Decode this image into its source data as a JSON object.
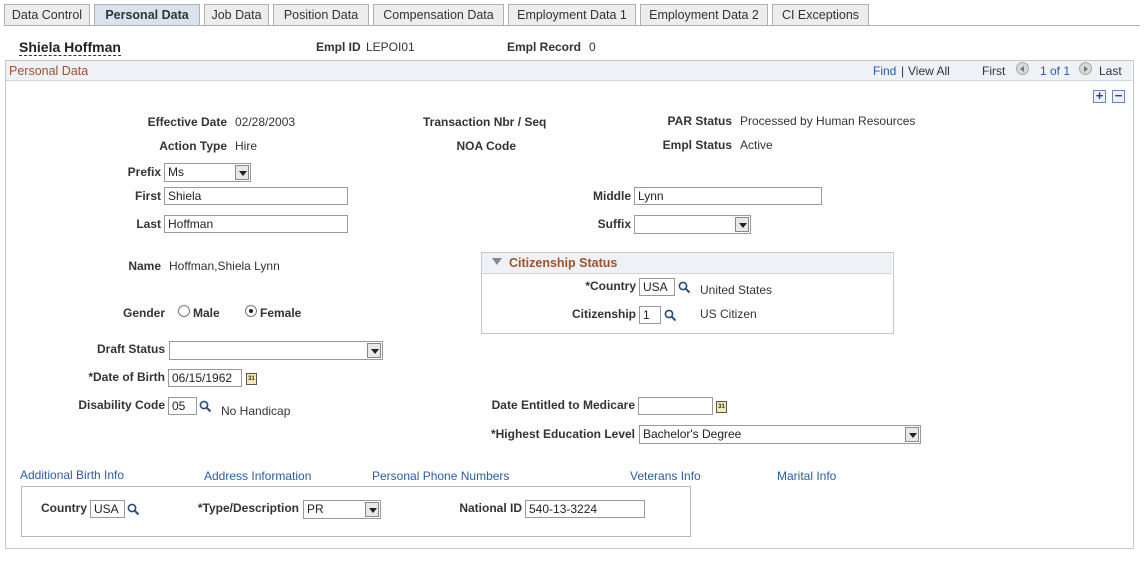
{
  "tabs": [
    {
      "label": "Data Control",
      "active": false
    },
    {
      "label": "Personal Data",
      "active": true
    },
    {
      "label": "Job Data",
      "active": false
    },
    {
      "label": "Position Data",
      "active": false
    },
    {
      "label": "Compensation Data",
      "active": false
    },
    {
      "label": "Employment Data 1",
      "active": false
    },
    {
      "label": "Employment Data 2",
      "active": false
    },
    {
      "label": "CI Exceptions",
      "active": false
    }
  ],
  "header": {
    "employee_name": "Shiela Hoffman",
    "empl_id_label": "Empl ID",
    "empl_id_value": "LEPOI01",
    "empl_record_label": "Empl Record",
    "empl_record_value": "0"
  },
  "section": {
    "title": "Personal Data",
    "find": "Find",
    "separator": "|",
    "view_all": "View All",
    "first": "First",
    "pagination": "1 of 1",
    "last": "Last",
    "add_symbol": "+",
    "remove_symbol": "−"
  },
  "fields": {
    "effective_date_label": "Effective Date",
    "effective_date_value": "02/28/2003",
    "transaction_label": "Transaction Nbr / Seq",
    "par_status_label": "PAR Status",
    "par_status_value": "Processed by Human Resources",
    "action_type_label": "Action Type",
    "action_type_value": "Hire",
    "noa_code_label": "NOA Code",
    "empl_status_label": "Empl Status",
    "empl_status_value": "Active",
    "prefix_label": "Prefix",
    "prefix_value": "Ms",
    "first_label": "First",
    "first_value": "Shiela",
    "middle_label": "Middle",
    "middle_value": "Lynn",
    "last_label": "Last",
    "last_value": "Hoffman",
    "suffix_label": "Suffix",
    "suffix_value": "",
    "name_label": "Name",
    "name_value": "Hoffman,Shiela Lynn",
    "gender_label": "Gender",
    "gender_male": "Male",
    "gender_female": "Female",
    "gender_selected": "Female",
    "draft_status_label": "Draft Status",
    "draft_status_value": "",
    "dob_label": "*Date of Birth",
    "dob_value": "06/15/1962",
    "disability_label": "Disability Code",
    "disability_value": "05",
    "disability_desc": "No Handicap",
    "medicare_label": "Date Entitled to Medicare",
    "medicare_value": "",
    "education_label": "*Highest Education Level",
    "education_value": "Bachelor's Degree"
  },
  "citizenship": {
    "title": "Citizenship Status",
    "country_label": "*Country",
    "country_value": "USA",
    "country_desc": "United States",
    "citizenship_label": "Citizenship",
    "citizenship_value": "1",
    "citizenship_desc": "US Citizen"
  },
  "links": {
    "birth": "Additional Birth Info",
    "address": "Address Information",
    "phone": "Personal Phone Numbers",
    "veterans": "Veterans Info",
    "marital": "Marital Info"
  },
  "national": {
    "country_label": "Country",
    "country_value": "USA",
    "type_label": "*Type/Description",
    "type_value": "PR",
    "id_label": "National ID",
    "id_value": "540-13-3224"
  },
  "colors": {
    "section_title": "#a0522d",
    "link": "#2a5ca8",
    "active_tab": "#d9e2ee",
    "header_bar": "#eef1f6"
  }
}
